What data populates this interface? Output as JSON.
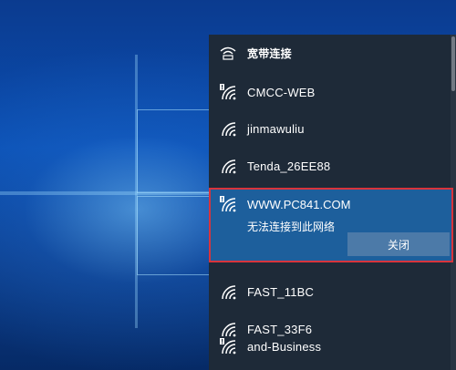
{
  "flyout": {
    "header": {
      "label": "宽带连接",
      "icon": "broadband-icon"
    },
    "networks": [
      {
        "ssid": "CMCC-WEB",
        "icon": "wifi-secured-warning-icon",
        "secured": false
      },
      {
        "ssid": "jinmawuliu",
        "icon": "wifi-icon",
        "secured": true
      },
      {
        "ssid": "Tenda_26EE88",
        "icon": "wifi-icon",
        "secured": true
      }
    ],
    "selected": {
      "ssid": "WWW.PC841.COM",
      "status": "无法连接到此网络",
      "close_label": "关闭",
      "icon": "wifi-warning-icon"
    },
    "networks_after": [
      {
        "ssid": "FAST_11BC",
        "icon": "wifi-icon"
      },
      {
        "ssid": "FAST_33F6",
        "icon": "wifi-icon"
      },
      {
        "ssid": "and-Business",
        "icon": "wifi-warning-icon"
      }
    ]
  },
  "colors": {
    "flyout_bg": "#1e2a38",
    "selected_bg": "#1d5f9c",
    "highlight_border": "#d8343c",
    "button_bg": "#4c7aa8"
  }
}
